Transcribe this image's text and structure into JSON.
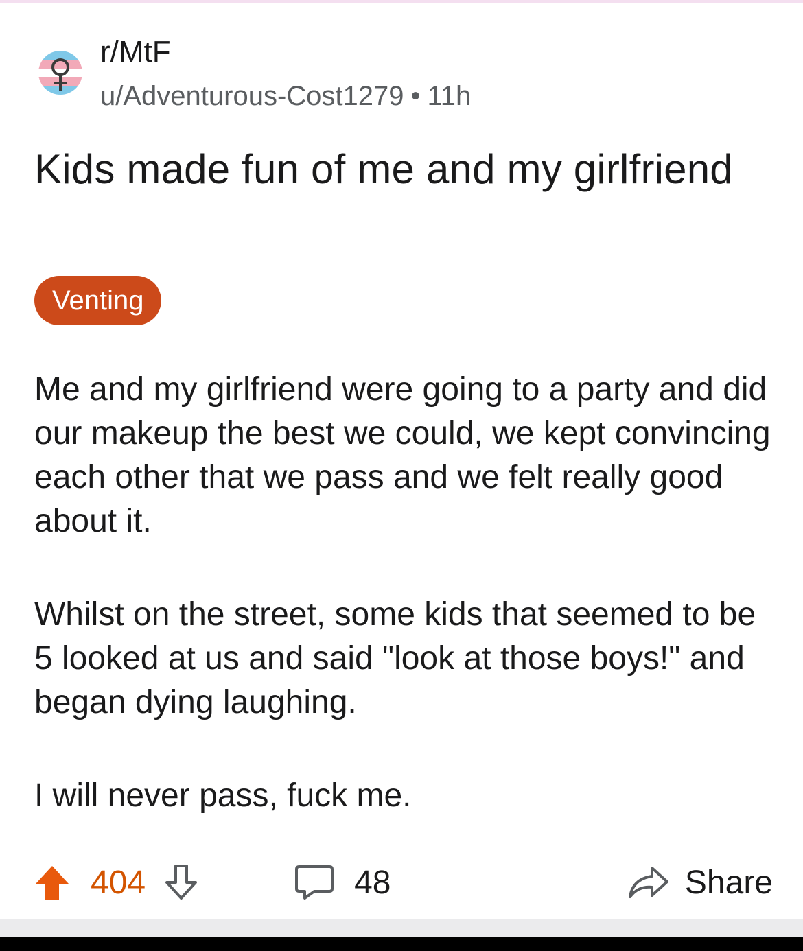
{
  "post": {
    "subreddit": "r/MtF",
    "author": "u/Adventurous-Cost1279",
    "separator": "•",
    "age": "11h",
    "subreddit_icon": "trans-flag-female-symbol-icon",
    "title": "Kids made fun of me and my girlfriend",
    "flair": "Venting",
    "body": [
      "Me and my girlfriend were going to a party and did our makeup the best we could, we kept convincing each other that we pass and we felt really good about it.",
      "Whilst on the street, some kids that seemed to be 5 looked at us and said \"look at those boys!\" and began dying laughing.",
      "I will never pass, fuck me."
    ]
  },
  "actions": {
    "upvote_icon": "upvote-arrow-icon",
    "score": "404",
    "downvote_icon": "downvote-arrow-icon",
    "comment_icon": "comment-bubble-icon",
    "comment_count": "48",
    "share_icon": "share-arrow-icon",
    "share_label": "Share"
  },
  "colors": {
    "flair_bg": "#cc4a1a",
    "upvoted": "#e8590c",
    "score": "#d35400",
    "muted_text": "#5a5d60",
    "trans_blue": "#7fc8e8",
    "trans_pink": "#f2a9b8"
  }
}
